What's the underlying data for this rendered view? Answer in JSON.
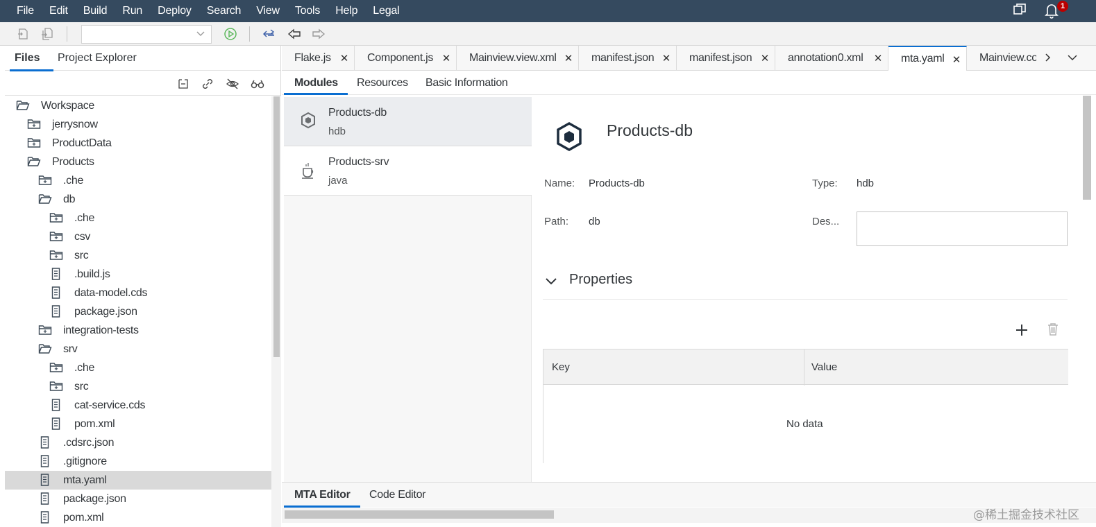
{
  "menu": [
    "File",
    "Edit",
    "Build",
    "Run",
    "Deploy",
    "Search",
    "View",
    "Tools",
    "Help",
    "Legal"
  ],
  "notifications": {
    "count": "1"
  },
  "left_panel": {
    "tabs": [
      "Files",
      "Project Explorer"
    ],
    "tree": [
      {
        "label": "Workspace",
        "type": "folder-open"
      },
      {
        "label": "jerrysnow",
        "type": "folder"
      },
      {
        "label": "ProductData",
        "type": "folder"
      },
      {
        "label": "Products",
        "type": "folder-open"
      },
      {
        "label": ".che",
        "type": "folder"
      },
      {
        "label": "db",
        "type": "folder-open"
      },
      {
        "label": ".che",
        "type": "folder"
      },
      {
        "label": "csv",
        "type": "folder"
      },
      {
        "label": "src",
        "type": "folder"
      },
      {
        "label": ".build.js",
        "type": "file"
      },
      {
        "label": "data-model.cds",
        "type": "file"
      },
      {
        "label": "package.json",
        "type": "file"
      },
      {
        "label": "integration-tests",
        "type": "folder"
      },
      {
        "label": "srv",
        "type": "folder-open"
      },
      {
        "label": ".che",
        "type": "folder"
      },
      {
        "label": "src",
        "type": "folder"
      },
      {
        "label": "cat-service.cds",
        "type": "file"
      },
      {
        "label": "pom.xml",
        "type": "file"
      },
      {
        "label": ".cdsrc.json",
        "type": "file"
      },
      {
        "label": ".gitignore",
        "type": "file"
      },
      {
        "label": "mta.yaml",
        "type": "file"
      },
      {
        "label": "package.json",
        "type": "file"
      },
      {
        "label": "pom.xml",
        "type": "file"
      }
    ]
  },
  "editor": {
    "tabs": [
      "Flake.js",
      "Component.js",
      "Mainview.view.xml",
      "manifest.json",
      "manifest.json",
      "annotation0.xml",
      "mta.yaml",
      "Mainview.coı"
    ],
    "subtabs": [
      "Modules",
      "Resources",
      "Basic Information"
    ],
    "modules": [
      {
        "name": "Products-db",
        "type": "hdb",
        "icon": "hdb-cube-icon"
      },
      {
        "name": "Products-srv",
        "type": "java",
        "icon": "java-cup-icon"
      }
    ],
    "detail": {
      "title": "Products-db",
      "name_label": "Name:",
      "name_value": "Products-db",
      "type_label": "Type:",
      "type_value": "hdb",
      "path_label": "Path:",
      "path_value": "db",
      "desc_label": "Des...",
      "properties_title": "Properties",
      "table": {
        "key_header": "Key",
        "value_header": "Value",
        "empty": "No data"
      }
    },
    "bottom_tabs": [
      "MTA Editor",
      "Code Editor"
    ]
  },
  "watermark": "@稀土掘金技术社区",
  "colors": {
    "menubar": "#354a5f",
    "accent": "#0a6ed1",
    "badge": "#bb0000",
    "selected_row": "#d9d9d9"
  }
}
